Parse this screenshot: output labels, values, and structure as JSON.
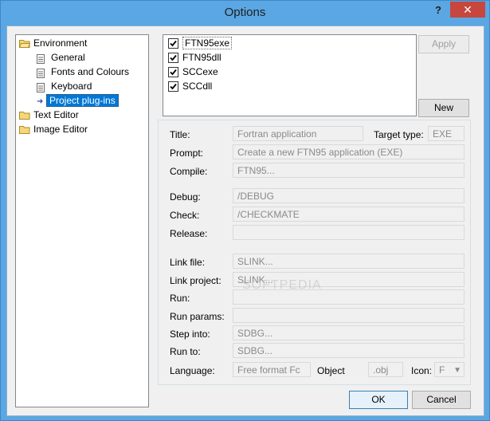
{
  "window": {
    "title": "Options",
    "help_label": "?",
    "close_label": "✕"
  },
  "tree": {
    "environment": "Environment",
    "general": "General",
    "fonts": "Fonts and Colours",
    "keyboard": "Keyboard",
    "plugins": "Project plug-ins",
    "text_editor": "Text Editor",
    "image_editor": "Image Editor"
  },
  "plugins": {
    "items": [
      {
        "label": "FTN95exe",
        "checked": true
      },
      {
        "label": "FTN95dll",
        "checked": true
      },
      {
        "label": "SCCexe",
        "checked": true
      },
      {
        "label": "SCCdll",
        "checked": true
      }
    ],
    "apply_label": "Apply",
    "new_label": "New"
  },
  "details": {
    "title_label": "Title:",
    "title_value": "Fortran application",
    "target_type_label": "Target type:",
    "target_type_value": "EXE",
    "prompt_label": "Prompt:",
    "prompt_value": "Create a new FTN95 application (EXE)",
    "compile_label": "Compile:",
    "compile_value": "FTN95...",
    "debug_label": "Debug:",
    "debug_value": "/DEBUG",
    "check_label": "Check:",
    "check_value": "/CHECKMATE",
    "release_label": "Release:",
    "release_value": "",
    "link_file_label": "Link file:",
    "link_file_value": "SLINK...",
    "link_project_label": "Link project:",
    "link_project_value": "SLINK...",
    "run_label": "Run:",
    "run_value": "",
    "run_params_label": "Run params:",
    "run_params_value": "",
    "step_into_label": "Step into:",
    "step_into_value": "SDBG...",
    "run_to_label": "Run to:",
    "run_to_value": "SDBG...",
    "language_label": "Language:",
    "language_value": "Free format Fc",
    "object_label": "Object",
    "object_value": ".obj",
    "icon_label": "Icon:",
    "icon_value": "F"
  },
  "footer": {
    "ok_label": "OK",
    "cancel_label": "Cancel"
  },
  "watermark": "SOFTPEDIA"
}
